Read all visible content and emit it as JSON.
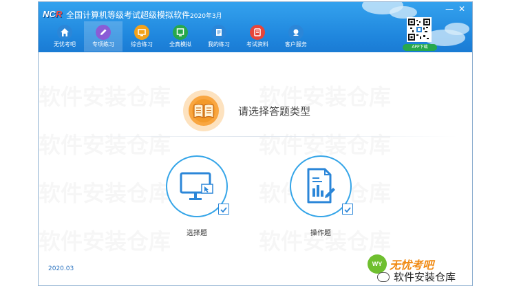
{
  "app": {
    "logo_text_main": "NC",
    "logo_text_accent": "R",
    "title": "全国计算机等级考试超级模拟软件",
    "title_date": "2020年3月"
  },
  "window_controls": {
    "minimize": "—",
    "close": "✕"
  },
  "nav": {
    "tabs": [
      {
        "label": "无忧考吧",
        "icon": "home-icon",
        "color": "#2b86d8",
        "active": false
      },
      {
        "label": "专项练习",
        "icon": "pencil-icon",
        "color": "#8a5cd6",
        "active": true
      },
      {
        "label": "综合练习",
        "icon": "monitor-icon",
        "color": "#f3a21b",
        "active": false
      },
      {
        "label": "全真模拟",
        "icon": "screen-icon",
        "color": "#27a84d",
        "active": false
      },
      {
        "label": "我的练习",
        "icon": "document-icon",
        "color": "#2b86d8",
        "active": false
      },
      {
        "label": "考试资料",
        "icon": "book-icon",
        "color": "#e6453a",
        "active": false
      },
      {
        "label": "客户服务",
        "icon": "support-icon",
        "color": "#2b86d8",
        "active": false
      }
    ]
  },
  "app_download": {
    "label": "APP下载"
  },
  "watermark": {
    "text": "软件安装仓库"
  },
  "main": {
    "prompt": "请选择答题类型",
    "choices": [
      {
        "label": "选择题",
        "icon": "monitor-cursor-icon"
      },
      {
        "label": "操作题",
        "icon": "document-chart-icon"
      }
    ]
  },
  "footer": {
    "version": "2020.03",
    "brand_logo_mark": "WY",
    "brand_name": "无忧考吧",
    "source_credit": "软件安装仓库"
  },
  "colors": {
    "titlebar": "#1f86dd",
    "accent_blue": "#35a5e8",
    "book_orange": "#f08a13",
    "app_green": "#27a84d"
  }
}
